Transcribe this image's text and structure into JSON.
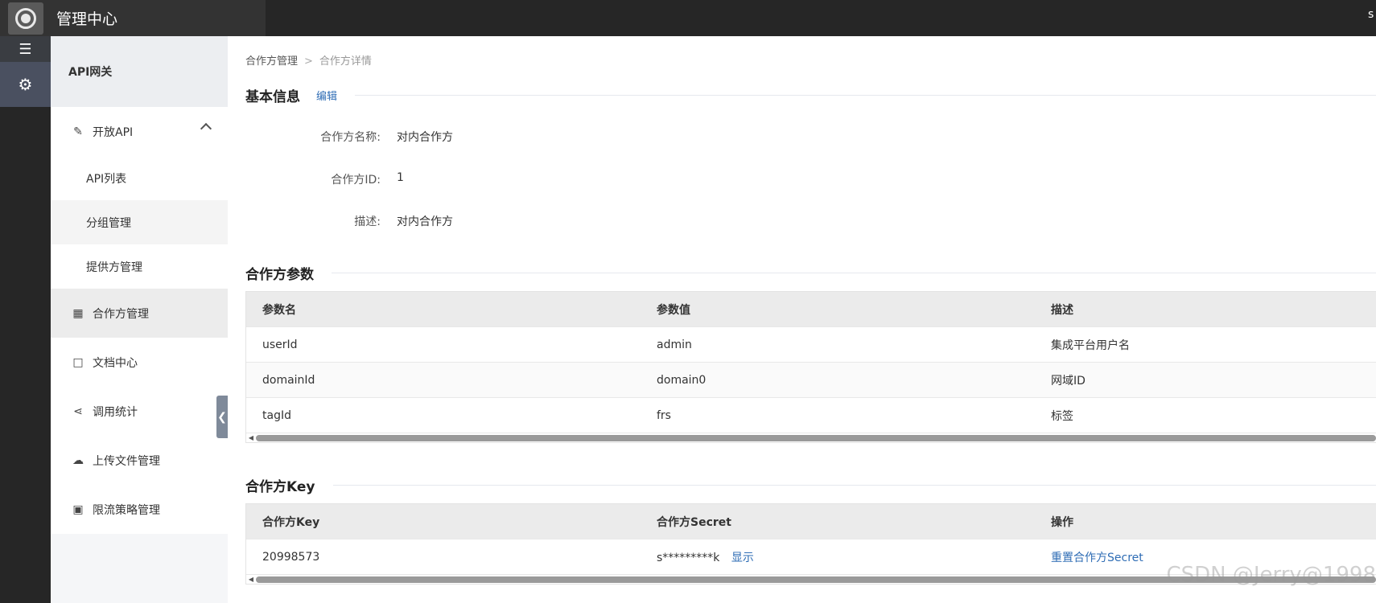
{
  "topbar": {
    "title": "管理中心",
    "user_initial": "s"
  },
  "sidebar": {
    "header": "API网关",
    "items": [
      {
        "label": "开放API",
        "icon": "pencil-icon"
      },
      {
        "label": "合作方管理",
        "icon": "grid-icon"
      },
      {
        "label": "文档中心",
        "icon": "document-icon"
      },
      {
        "label": "调用统计",
        "icon": "share-icon"
      },
      {
        "label": "上传文件管理",
        "icon": "cloud-upload-icon"
      },
      {
        "label": "限流策略管理",
        "icon": "calendar-icon"
      }
    ],
    "sub_items": [
      "API列表",
      "分组管理",
      "提供方管理"
    ]
  },
  "breadcrumb": {
    "parent": "合作方管理",
    "separator": ">",
    "current": "合作方详情"
  },
  "basic_info": {
    "title": "基本信息",
    "edit_label": "编辑",
    "fields": [
      {
        "key": "合作方名称:",
        "value": "对内合作方"
      },
      {
        "key": "合作方ID:",
        "value": "1"
      },
      {
        "key": "描述:",
        "value": "对内合作方"
      }
    ]
  },
  "params": {
    "title": "合作方参数",
    "headers": [
      "参数名",
      "参数值",
      "描述"
    ],
    "rows": [
      [
        "userId",
        "admin",
        "集成平台用户名"
      ],
      [
        "domainId",
        "domain0",
        "网域ID"
      ],
      [
        "tagId",
        "frs",
        "标签"
      ]
    ]
  },
  "keys": {
    "title": "合作方Key",
    "headers": [
      "合作方Key",
      "合作方Secret",
      "操作"
    ],
    "row": {
      "key": "20998573",
      "secret": "s*********k",
      "show_label": "显示",
      "action_label": "重置合作方Secret"
    }
  },
  "watermark": "CSDN @Jerry@1998"
}
